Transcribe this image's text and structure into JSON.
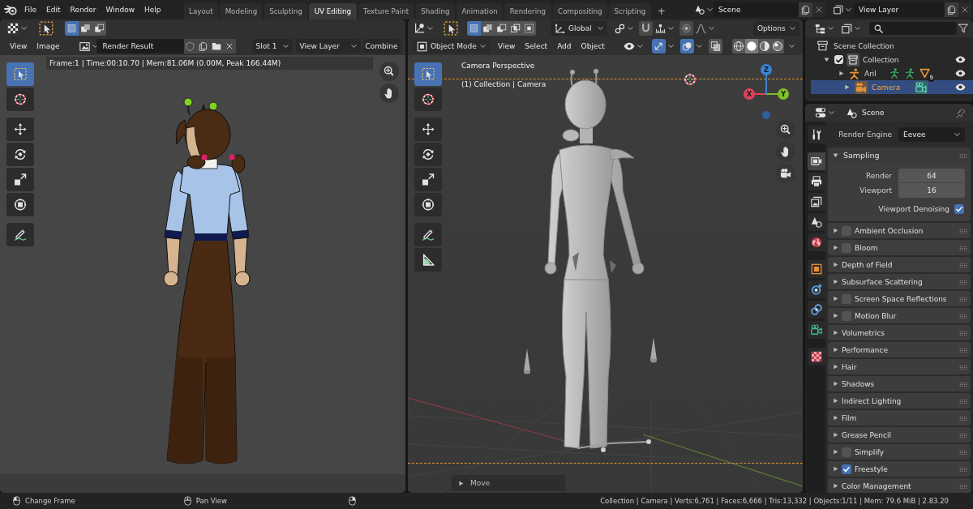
{
  "top_bar": {
    "menus": [
      "File",
      "Edit",
      "Render",
      "Window",
      "Help"
    ],
    "workspaces": [
      {
        "label": "Layout",
        "selected": false
      },
      {
        "label": "Modeling",
        "selected": false
      },
      {
        "label": "Sculpting",
        "selected": false
      },
      {
        "label": "UV Editing",
        "selected": true
      },
      {
        "label": "Texture Paint",
        "selected": false
      },
      {
        "label": "Shading",
        "selected": false
      },
      {
        "label": "Animation",
        "selected": false
      },
      {
        "label": "Rendering",
        "selected": false
      },
      {
        "label": "Compositing",
        "selected": false
      },
      {
        "label": "Scripting",
        "selected": false
      }
    ],
    "add_workspace": "+",
    "scene": "Scene",
    "view_layer": "View Layer"
  },
  "image_editor": {
    "select_modes": [
      {
        "kind": "set",
        "selected": true
      },
      {
        "kind": "extend",
        "selected": false
      },
      {
        "kind": "subtract",
        "selected": false
      }
    ],
    "menus": [
      "View",
      "Image"
    ],
    "image": "Render Result",
    "slot": "Slot 1",
    "layer": "View Layer",
    "pass": "Combine",
    "render_info": "Frame:1 | Time:00:10.70 | Mem:81.06M (0.00M, Peak 166.44M)",
    "tools": [
      {
        "kind": "select_box",
        "selected": true
      },
      {
        "kind": "cursor",
        "selected": false
      },
      {
        "kind": "move",
        "selected": false
      },
      {
        "kind": "rotate",
        "selected": false
      },
      {
        "kind": "scale",
        "selected": false
      },
      {
        "kind": "transform",
        "selected": false
      },
      {
        "kind": "annotate",
        "selected": false
      }
    ]
  },
  "viewport": {
    "select_modes": [
      {
        "kind": "set",
        "selected": true
      },
      {
        "kind": "extend",
        "selected": false
      },
      {
        "kind": "subtract",
        "selected": false
      },
      {
        "kind": "difference",
        "selected": false
      },
      {
        "kind": "intersect",
        "selected": false
      }
    ],
    "orientation": "Global",
    "snapping": [
      {
        "kind": "snap",
        "on": false
      },
      {
        "kind": "proportional",
        "on": false
      }
    ],
    "options": "Options",
    "mode": "Object Mode",
    "menus": [
      "View",
      "Select",
      "Add",
      "Object"
    ],
    "display_toggles": [
      {
        "kind": "gizmo",
        "on": true
      },
      {
        "kind": "overlay",
        "on": true
      },
      {
        "kind": "xray",
        "on": false
      }
    ],
    "shading": [
      {
        "kind": "wireframe",
        "selected": false
      },
      {
        "kind": "solid",
        "selected": true
      },
      {
        "kind": "material",
        "selected": false
      },
      {
        "kind": "rendered",
        "selected": false
      }
    ],
    "view_name": "Camera Perspective",
    "view_context": "(1) Collection | Camera",
    "axes": [
      {
        "label": "X",
        "color": "#e0415a"
      },
      {
        "label": "Y",
        "color": "#7fbf26"
      },
      {
        "label": "Z",
        "color": "#3b83d6"
      }
    ],
    "tools": [
      {
        "kind": "select_box",
        "selected": true
      },
      {
        "kind": "cursor",
        "selected": false
      },
      {
        "kind": "move",
        "selected": false
      },
      {
        "kind": "rotate",
        "selected": false
      },
      {
        "kind": "scale",
        "selected": false
      },
      {
        "kind": "transform",
        "selected": false
      },
      {
        "kind": "annotate",
        "selected": false
      },
      {
        "kind": "measure",
        "selected": false
      }
    ],
    "last_operator": "Move"
  },
  "outliner": {
    "tree": [
      {
        "label": "Scene Collection",
        "kind": "scene_collection",
        "selected": false,
        "children": [
          {
            "label": "Collection",
            "kind": "collection",
            "selected": false,
            "expanded": true,
            "checked": true,
            "visible": true,
            "children": [
              {
                "label": "Aril",
                "kind": "armature",
                "selected": false,
                "expanded": false,
                "visible": true,
                "badge": "9"
              },
              {
                "label": "Camera",
                "kind": "camera",
                "selected": true,
                "expanded": false,
                "visible": true
              }
            ]
          }
        ]
      }
    ]
  },
  "properties": {
    "context": "Scene",
    "tabs": [
      {
        "kind": "tool",
        "selected": false
      },
      {
        "kind": "render",
        "selected": true
      },
      {
        "kind": "output",
        "selected": false
      },
      {
        "kind": "view_layer",
        "selected": false
      },
      {
        "kind": "scene",
        "selected": false
      },
      {
        "kind": "world",
        "selected": false
      },
      {
        "kind": "object",
        "selected": false
      },
      {
        "kind": "physics",
        "selected": false
      },
      {
        "kind": "constraints",
        "selected": false
      },
      {
        "kind": "data",
        "selected": false
      },
      {
        "kind": "texture",
        "selected": false
      }
    ],
    "render_engine": {
      "label": "Render Engine",
      "value": "Eevee"
    },
    "panels": [
      {
        "title": "Sampling",
        "kind": "section",
        "expanded": true,
        "fields": [
          {
            "label": "Render",
            "value": "64"
          },
          {
            "label": "Viewport",
            "value": "16"
          }
        ],
        "toggles": [
          {
            "label": "Viewport Denoising",
            "checked": true
          }
        ]
      },
      {
        "title": "Ambient Occlusion",
        "kind": "toggle_section",
        "expanded": false,
        "checked": false
      },
      {
        "title": "Bloom",
        "kind": "toggle_section",
        "expanded": false,
        "checked": false
      },
      {
        "title": "Depth of Field",
        "kind": "section",
        "expanded": false
      },
      {
        "title": "Subsurface Scattering",
        "kind": "section",
        "expanded": false
      },
      {
        "title": "Screen Space Reflections",
        "kind": "toggle_section",
        "expanded": false,
        "checked": false
      },
      {
        "title": "Motion Blur",
        "kind": "toggle_section",
        "expanded": false,
        "checked": false
      },
      {
        "title": "Volumetrics",
        "kind": "section",
        "expanded": false
      },
      {
        "title": "Performance",
        "kind": "section",
        "expanded": false
      },
      {
        "title": "Hair",
        "kind": "section",
        "expanded": false
      },
      {
        "title": "Shadows",
        "kind": "section",
        "expanded": false
      },
      {
        "title": "Indirect Lighting",
        "kind": "section",
        "expanded": false
      },
      {
        "title": "Film",
        "kind": "section",
        "expanded": false
      },
      {
        "title": "Grease Pencil",
        "kind": "section",
        "expanded": false
      },
      {
        "title": "Simplify",
        "kind": "toggle_section",
        "expanded": false,
        "checked": false
      },
      {
        "title": "Freestyle",
        "kind": "toggle_section",
        "expanded": false,
        "checked": true
      },
      {
        "title": "Color Management",
        "kind": "section",
        "expanded": false
      }
    ]
  },
  "status_bar": {
    "hints": [
      {
        "kind": "left_click",
        "label": "Change Frame"
      },
      {
        "kind": "middle_click",
        "label": "Pan View"
      }
    ],
    "stats": "Collection | Camera | Verts:6,761 | Faces:6,666 | Tris:13,332 | Objects:1/11 | Mem: 79.6 MiB | 2.83.20"
  }
}
